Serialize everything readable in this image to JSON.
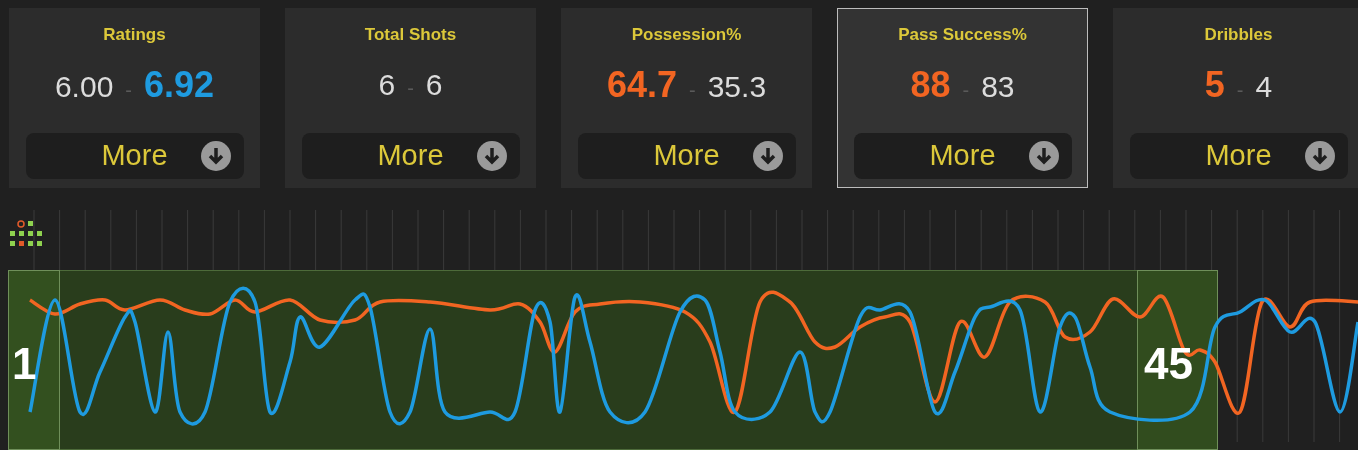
{
  "stat_cards": [
    {
      "title": "Ratings",
      "home": "6.00",
      "separator": "-",
      "away": "6.92",
      "home_leads": false,
      "away_leads": true,
      "button": "More",
      "selected": false
    },
    {
      "title": "Total Shots",
      "home": "6",
      "separator": "-",
      "away": "6",
      "home_leads": false,
      "away_leads": false,
      "button": "More",
      "selected": false
    },
    {
      "title": "Possession%",
      "home": "64.7",
      "separator": "-",
      "away": "35.3",
      "home_leads": true,
      "away_leads": false,
      "button": "More",
      "selected": false
    },
    {
      "title": "Pass Success%",
      "home": "88",
      "separator": "-",
      "away": "83",
      "home_leads": true,
      "away_leads": false,
      "button": "More",
      "selected": true
    },
    {
      "title": "Dribbles",
      "home": "5",
      "separator": "-",
      "away": "4",
      "home_leads": true,
      "away_leads": false,
      "button": "More",
      "selected": false
    }
  ],
  "timeline": {
    "period_markers": [
      {
        "label": "1"
      },
      {
        "label": "45"
      }
    ]
  }
}
